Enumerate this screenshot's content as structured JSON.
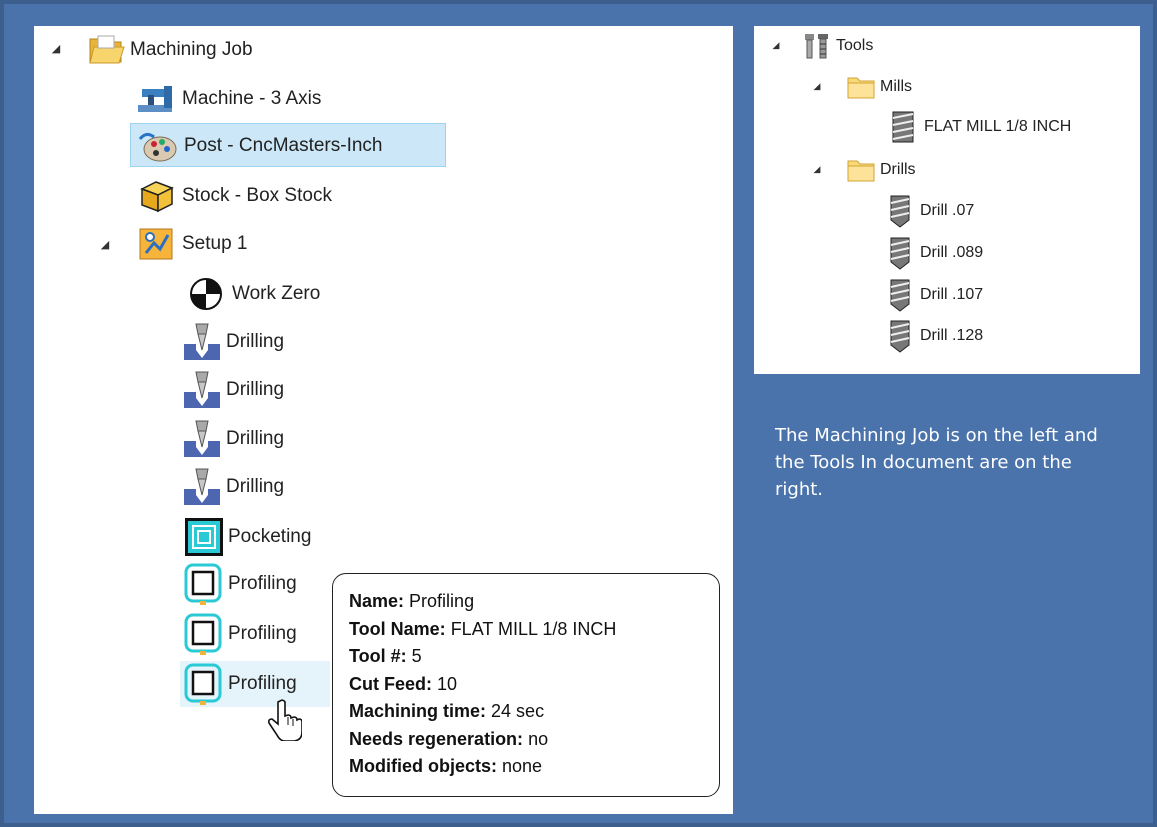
{
  "machining_tree": {
    "root": "Machining Job",
    "machine": "Machine - 3 Axis",
    "post": "Post - CncMasters-Inch",
    "stock": "Stock - Box Stock",
    "setup": "Setup 1",
    "work_zero": "Work Zero",
    "operations": [
      "Drilling",
      "Drilling",
      "Drilling",
      "Drilling",
      "Pocketing",
      "Profiling",
      "Profiling",
      "Profiling"
    ]
  },
  "tools_tree": {
    "root": "Tools",
    "mills_folder": "Mills",
    "mills": [
      "FLAT MILL 1/8 INCH"
    ],
    "drills_folder": "Drills",
    "drills": [
      "Drill .07",
      "Drill .089",
      "Drill .107",
      "Drill .128"
    ]
  },
  "tooltip": {
    "name_label": "Name:",
    "name_value": "Profiling",
    "tool_name_label": "Tool Name:",
    "tool_name_value": "FLAT MILL 1/8 INCH",
    "tool_num_label": "Tool #:",
    "tool_num_value": "5",
    "cut_feed_label": "Cut Feed:",
    "cut_feed_value": "10",
    "time_label": "Machining time:",
    "time_value": "24 sec",
    "regen_label": "Needs regeneration:",
    "regen_value": "no",
    "modified_label": "Modified objects:",
    "modified_value": "none"
  },
  "caption": "The Machining Job is on the left and the Tools In document are on the right."
}
